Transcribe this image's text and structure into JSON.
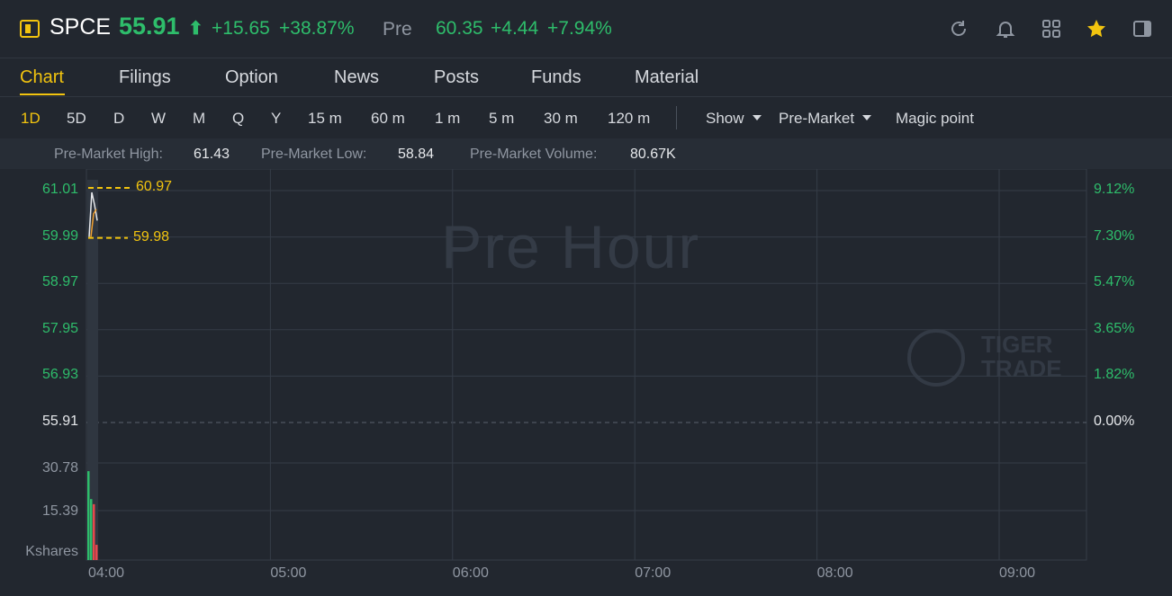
{
  "header": {
    "ticker": "SPCE",
    "price": "55.91",
    "arrow": "⬆",
    "change": "+15.65",
    "change_pct": "+38.87%",
    "pre_label": "Pre",
    "pre_price": "60.35",
    "pre_change": "+4.44",
    "pre_change_pct": "+7.94%",
    "icons": [
      "refresh-icon",
      "bell-icon",
      "grid-icon",
      "star-icon",
      "panel-icon"
    ],
    "colors": {
      "up": "#2ebd6b",
      "accent": "#f2c40f",
      "down": "#e5484d"
    }
  },
  "tabs": [
    {
      "label": "Chart",
      "active": true
    },
    {
      "label": "Filings"
    },
    {
      "label": "Option"
    },
    {
      "label": "News"
    },
    {
      "label": "Posts"
    },
    {
      "label": "Funds"
    },
    {
      "label": "Material"
    }
  ],
  "periods": [
    "1D",
    "5D",
    "D",
    "W",
    "M",
    "Q",
    "Y",
    "15 m",
    "60 m",
    "1 m",
    "5 m",
    "30 m",
    "120 m"
  ],
  "toolbar": {
    "show_label": "Show",
    "premarket_label": "Pre-Market",
    "magic_label": "Magic point"
  },
  "stats": {
    "high_label": "Pre-Market High:",
    "high_value": "61.43",
    "low_label": "Pre-Market Low:",
    "low_value": "58.84",
    "volume_label": "Pre-Market Volume:",
    "volume_value": "80.67K"
  },
  "chart": {
    "watermark": "Pre Hour",
    "brand_line1": "TIGER",
    "brand_line2": "TRADE",
    "high_marker": "60.97",
    "low_marker": "59.98",
    "volume_unit": "Kshares"
  },
  "chart_data": {
    "type": "line",
    "x_ticks": [
      "04:00",
      "05:00",
      "06:00",
      "07:00",
      "08:00",
      "09:00"
    ],
    "y_ticks_left": [
      "61.01",
      "59.99",
      "58.97",
      "57.95",
      "56.93",
      "55.91"
    ],
    "y_ticks_right": [
      "9.12%",
      "7.30%",
      "5.47%",
      "3.65%",
      "1.82%",
      "0.00%"
    ],
    "ylim": [
      55.91,
      61.01
    ],
    "baseline": 55.91,
    "series": [
      {
        "values": [
          59.99,
          60.97,
          60.7,
          60.35
        ]
      }
    ],
    "volume_ticks": [
      "30.78",
      "15.39"
    ],
    "volume_bars": [
      {
        "value": 35,
        "color": "up"
      },
      {
        "value": 24,
        "color": "up"
      },
      {
        "value": 22,
        "color": "down"
      },
      {
        "value": 6,
        "color": "down"
      }
    ],
    "grid": true
  }
}
